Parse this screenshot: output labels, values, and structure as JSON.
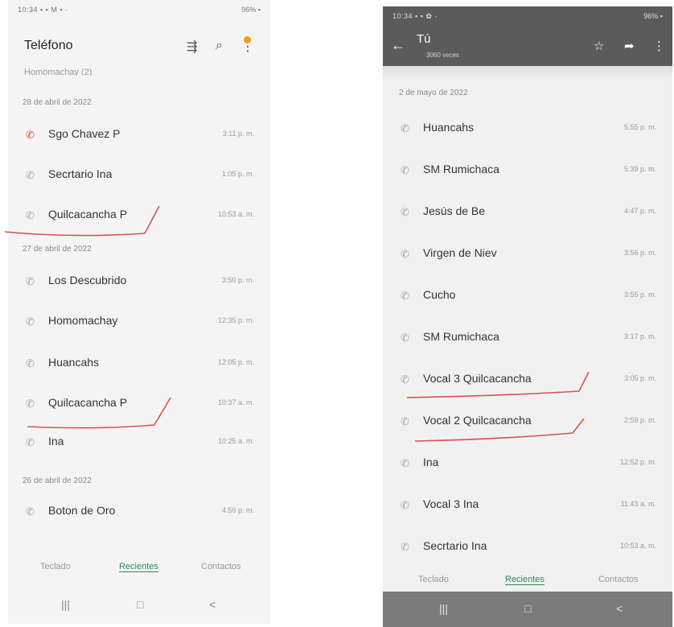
{
  "left": {
    "status_left": "10:34 ▪ ▪ M ▪ ·",
    "status_right": "96% ▪",
    "app_title": "Teléfono",
    "partial_row": "Homomachay (2)",
    "sections": [
      {
        "date": "28 de abril de 2022",
        "calls": [
          {
            "name": "Sgo Chavez P",
            "time": "3:11 p. m.",
            "missed": true
          },
          {
            "name": "Secrtario Ina",
            "time": "1:05 p. m.",
            "missed": false
          },
          {
            "name": "Quilcacancha P",
            "time": "10:53 a. m.",
            "missed": false
          }
        ]
      },
      {
        "date": "27 de abril de 2022",
        "calls": [
          {
            "name": "Los Descubrido",
            "time": "3:50 p. m.",
            "missed": false
          },
          {
            "name": "Homomachay",
            "time": "12:35 p. m.",
            "missed": false
          },
          {
            "name": "Huancahs",
            "time": "12:05 p. m.",
            "missed": false
          },
          {
            "name": "Quilcacancha P",
            "time": "10:37 a. m.",
            "missed": false
          },
          {
            "name": "Ina",
            "time": "10:25 a. m.",
            "missed": false
          }
        ]
      },
      {
        "date": "26 de abril de 2022",
        "calls": [
          {
            "name": "Boton de Oro",
            "time": "4:56 p. m.",
            "missed": false
          }
        ]
      }
    ],
    "tabs": [
      "Teclado",
      "Recientes",
      "Contactos"
    ],
    "nav": [
      "|||",
      "□",
      "<"
    ]
  },
  "right": {
    "status_left": "10:34 ▪ ▪ ✿ ·",
    "status_right": "96% ▪",
    "header_title": "Tú",
    "header_sub": "3060 veces",
    "date": "2 de mayo de 2022",
    "calls": [
      {
        "name": "Huancahs",
        "time": "5:55 p. m."
      },
      {
        "name": "SM Rumichaca",
        "time": "5:39 p. m."
      },
      {
        "name": "Jesús de Be",
        "time": "4:47 p. m."
      },
      {
        "name": "Virgen de Niev",
        "time": "3:56 p. m."
      },
      {
        "name": "Cucho",
        "time": "3:55 p. m."
      },
      {
        "name": "SM Rumichaca",
        "time": "3:17 p. m."
      },
      {
        "name": "Vocal 3 Quilcacancha",
        "time": "3:05 p. m."
      },
      {
        "name": "Vocal 2 Quilcacancha",
        "time": "2:59 p. m."
      },
      {
        "name": "Ina",
        "time": "12:52 p. m."
      },
      {
        "name": "Vocal 3 Ina",
        "time": "11:43 a. m."
      },
      {
        "name": "Secrtario Ina",
        "time": "10:53 a. m."
      }
    ],
    "tabs": [
      "Teclado",
      "Recientes",
      "Contactos"
    ],
    "nav": [
      "|||",
      "□",
      "<"
    ]
  },
  "colors": {
    "accent": "#2e8b57",
    "missed": "#d04c40",
    "annotation": "#d9534f",
    "header": "#5b5b5b"
  },
  "icons": [
    "call-icon",
    "missed-call-icon",
    "filter-icon",
    "search-icon",
    "more-icon",
    "back-icon",
    "star-icon",
    "share-icon"
  ]
}
